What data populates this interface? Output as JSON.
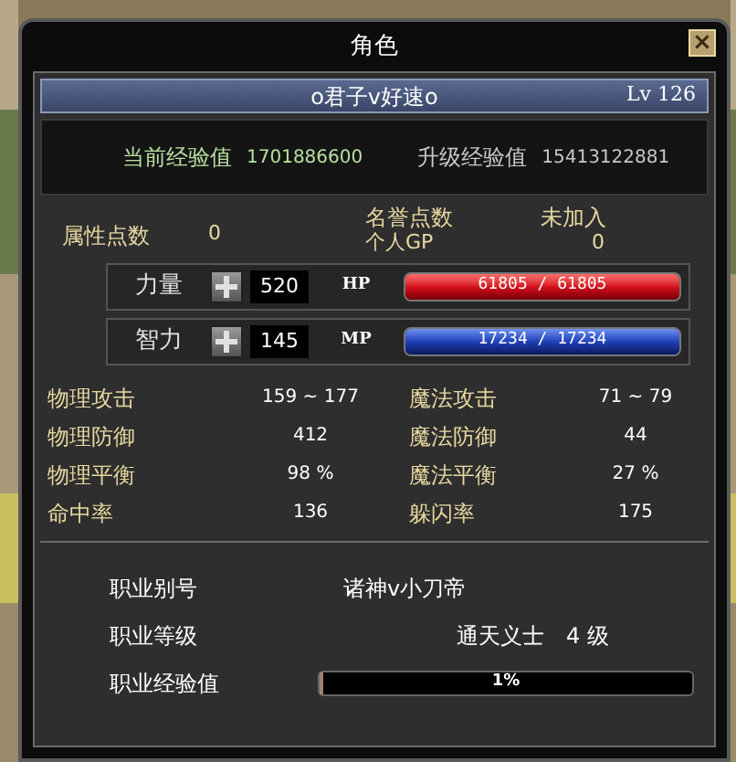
{
  "window": {
    "title": "角色",
    "close": "×"
  },
  "character": {
    "name": "o君子v好速o",
    "level": "Lv 126"
  },
  "experience": [
    {
      "label": "当前经验值",
      "value": "1701886600",
      "kind": "current"
    },
    {
      "label": "升级经验值",
      "value": "15413122881",
      "kind": "next"
    }
  ],
  "points": {
    "attribute_label": "属性点数",
    "attribute_value": "0",
    "honor_label": "名誉点数",
    "honor_value": "未加入",
    "gp_label": "个人GP",
    "gp_value": "0"
  },
  "attributes": [
    {
      "label": "力量",
      "value": "520",
      "bar_label": "HP",
      "reading": "61805 / 61805",
      "level": 1,
      "kind": "hp"
    },
    {
      "label": "智力",
      "value": "145",
      "bar_label": "MP",
      "reading": "17234 / 17234",
      "level": 1,
      "kind": "mp"
    }
  ],
  "stats": [
    {
      "label": "物理攻击",
      "value": "159 ~ 177",
      "label_2": "魔法攻击",
      "value_2": "71 ~ 79"
    },
    {
      "label": "物理防御",
      "value": "412",
      "label_2": "魔法防御",
      "value_2": "44"
    },
    {
      "label": "物理平衡",
      "value": "98 %",
      "label_2": "魔法平衡",
      "value_2": "27 %"
    },
    {
      "label": "命中率",
      "value": "136",
      "label_2": "躲闪率",
      "value_2": "175"
    }
  ],
  "job": {
    "alias_label": "职业别号",
    "alias": "诸神v小刀帝",
    "level_label": "职业等级",
    "title": "通天义士",
    "grade": "4 级",
    "experience": {
      "label": "职业经验值",
      "level": 0.01,
      "reading": "1%"
    }
  }
}
